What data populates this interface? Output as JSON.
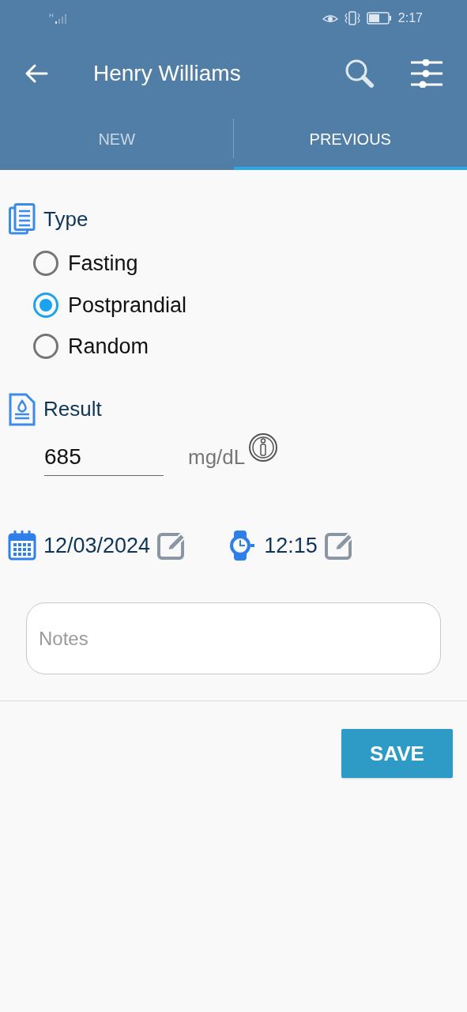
{
  "status_bar": {
    "time": "2:17",
    "network_label": "H"
  },
  "app_bar": {
    "title": "Henry Williams"
  },
  "tabs": [
    {
      "label": "NEW",
      "selected": false
    },
    {
      "label": "PREVIOUS",
      "selected": true
    }
  ],
  "type_section": {
    "heading": "Type",
    "options": [
      {
        "label": "Fasting",
        "selected": false
      },
      {
        "label": "Postprandial",
        "selected": true
      },
      {
        "label": "Random",
        "selected": false
      }
    ]
  },
  "result_section": {
    "heading": "Result",
    "value": "685",
    "unit": "mg/dL"
  },
  "date": "12/03/2024",
  "time": "12:15",
  "notes": {
    "placeholder": "Notes"
  },
  "buttons": [
    {
      "label": "SAVE"
    }
  ]
}
